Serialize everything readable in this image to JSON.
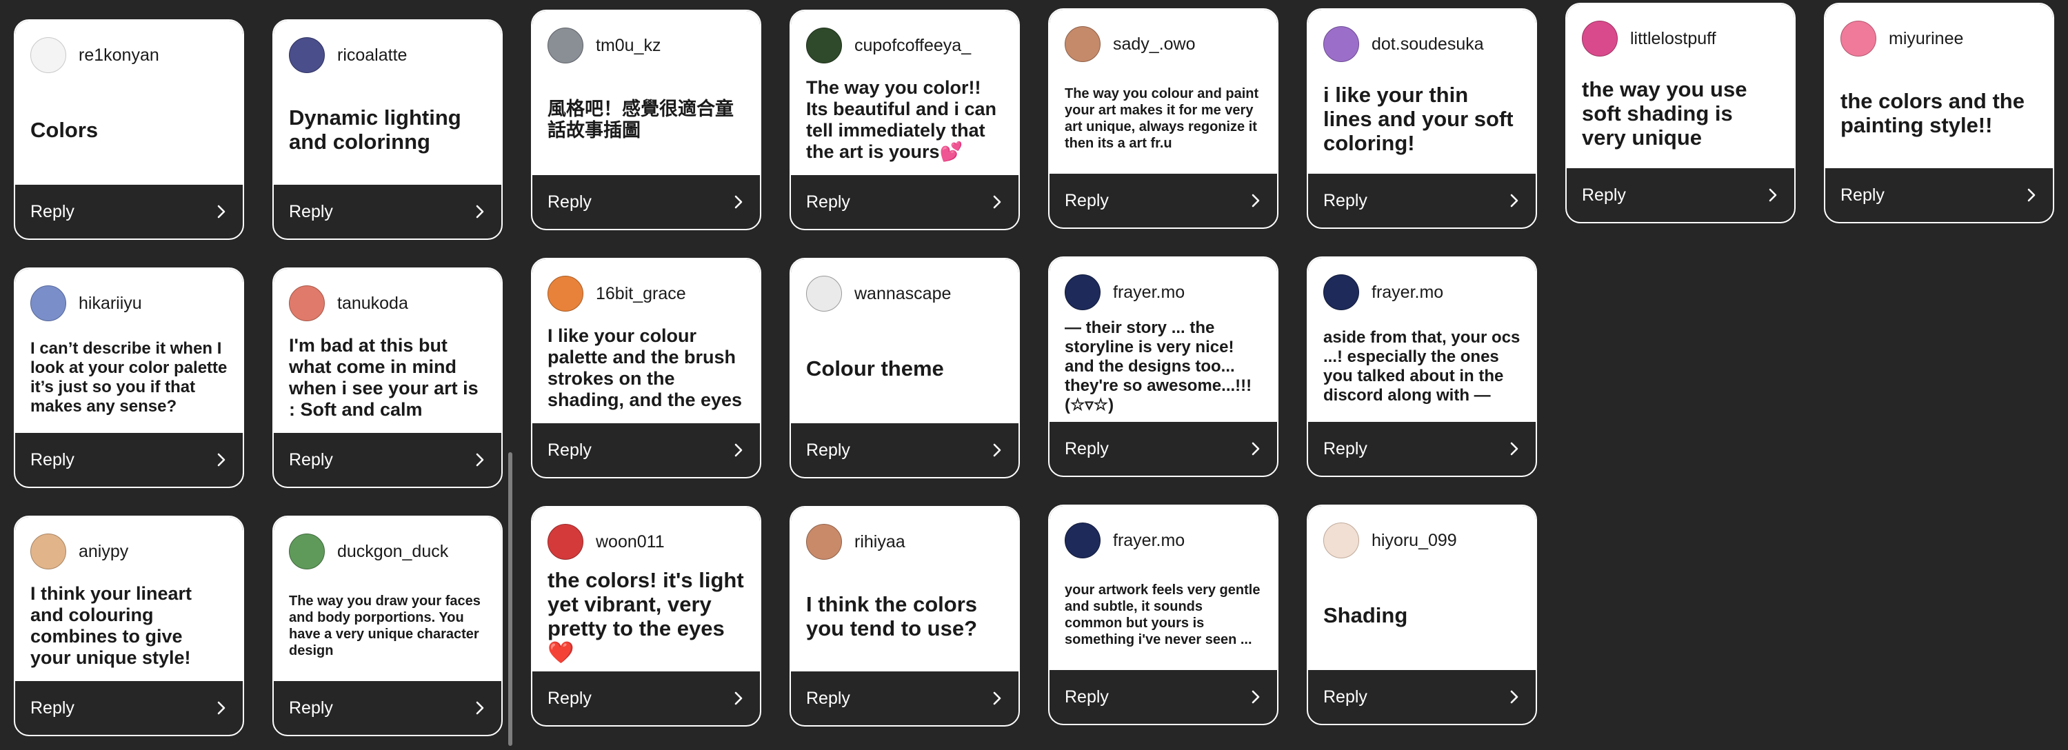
{
  "reply_label": "Reply",
  "icons": {
    "reply_chevron": "chevron-right-icon"
  },
  "cards": [
    {
      "user": "re1konyan",
      "text": "Colors",
      "size": "l",
      "avatar_color": "#f4f4f4",
      "avatar_border": "#c9c9c9"
    },
    {
      "user": "ricoalatte",
      "text": "Dynamic lighting and colorinng",
      "size": "l",
      "avatar_color": "#4a4e8a",
      "avatar_border": "#2f3263"
    },
    {
      "user": "tm0u_kz",
      "text": "風格吧！感覺很適合童話故事插圖",
      "size": "m",
      "avatar_color": "#8a8f96",
      "avatar_border": "#5d6167"
    },
    {
      "user": "cupofcoffeeya_",
      "text": "The way you color!! Its beautiful and i can tell immediately that the art is yours💕",
      "size": "m",
      "avatar_color": "#2f4a2a",
      "avatar_border": "#1e301b"
    },
    {
      "user": "sady_.owo",
      "text": "The way you colour and paint your art makes it for me very art unique, always regonize it then its a art fr.u",
      "size": "xs",
      "avatar_color": "#c58a6a",
      "avatar_border": "#8e5f47"
    },
    {
      "user": "dot.soudesuka",
      "text": "i like your thin lines and your soft coloring!",
      "size": "l",
      "avatar_color": "#9b6fc9",
      "avatar_border": "#6c4a93"
    },
    {
      "user": "littlelostpuff",
      "text": "the way you use soft shading is very unique",
      "size": "l",
      "avatar_color": "#d94a8c",
      "avatar_border": "#9e3263"
    },
    {
      "user": "miyurinee",
      "text": "the colors and the painting style!!",
      "size": "l",
      "avatar_color": "#f07a9a",
      "avatar_border": "#b4566f"
    },
    {
      "user": "hikariiyu",
      "text": "I can’t describe it when I look at your color palette it’s just so you if that makes any sense?",
      "size": "s",
      "avatar_color": "#7a8fc9",
      "avatar_border": "#55669a"
    },
    {
      "user": "tanukoda",
      "text": "I'm bad at this but what come in mind when i see your art is : Soft and calm",
      "size": "m",
      "avatar_color": "#e07a6a",
      "avatar_border": "#a5584a"
    },
    {
      "user": "16bit_grace",
      "text": "I like your colour palette and the brush strokes on the shading, and the eyes",
      "size": "m",
      "avatar_color": "#e8823a",
      "avatar_border": "#a85c26"
    },
    {
      "user": "wannascape",
      "text": "Colour theme",
      "size": "l",
      "avatar_color": "#eaeaea",
      "avatar_border": "#9a9a9a"
    },
    {
      "user": "frayer.mo",
      "text": "— their story ... the storyline is very nice! and the designs too... they're so awesome...!!! (☆▿☆)",
      "size": "s",
      "avatar_color": "#1d2a5a",
      "avatar_border": "#111a3a"
    },
    {
      "user": "frayer.mo",
      "text": "aside from that, your ocs ...! especially the ones you talked about in the discord along with —",
      "size": "s",
      "avatar_color": "#1d2a5a",
      "avatar_border": "#111a3a"
    },
    {
      "user": "aniypy",
      "text": "I think your lineart and colouring combines to give your unique style!",
      "size": "m",
      "avatar_color": "#e2b48a",
      "avatar_border": "#a88563"
    },
    {
      "user": "duckgon_duck",
      "text": "The way you draw your faces and body porportions. You have a very unique character design",
      "size": "xs",
      "avatar_color": "#5f9a5a",
      "avatar_border": "#3f6b3c"
    },
    {
      "user": "woon011",
      "text": "the colors! it's light yet vibrant, very pretty to the eyes ❤️",
      "size": "l",
      "avatar_color": "#d43a3a",
      "avatar_border": "#962828"
    },
    {
      "user": "rihiyaa",
      "text": "I think the colors you tend to use?",
      "size": "l",
      "avatar_color": "#c98a6a",
      "avatar_border": "#8e6149"
    },
    {
      "user": "frayer.mo",
      "text": "your artwork feels very gentle and subtle, it sounds common but yours is something i've never seen ...",
      "size": "xs",
      "avatar_color": "#1d2a5a",
      "avatar_border": "#111a3a"
    },
    {
      "user": "hiyoru_099",
      "text": "Shading",
      "size": "l",
      "avatar_color": "#f1dfd3",
      "avatar_border": "#bfa99a"
    }
  ]
}
